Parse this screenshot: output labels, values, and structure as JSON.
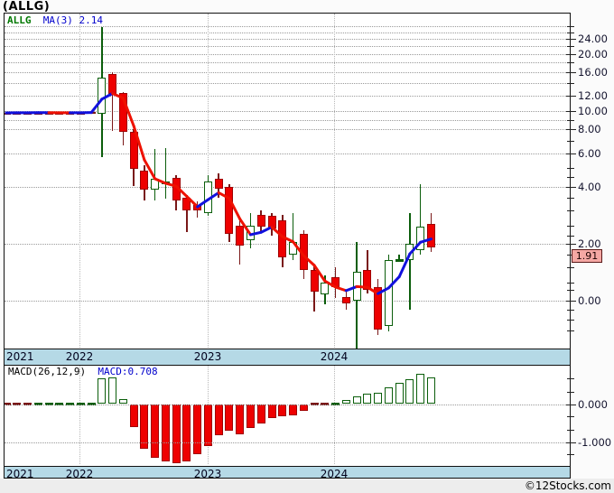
{
  "title": "(ALLG)",
  "legend": {
    "symbol": "ALLG",
    "ma_label": "MA(3)",
    "ma_value": "2.14"
  },
  "price_badge": "1.91",
  "watermark": "©12Stocks.com",
  "x_axis": {
    "years": [
      "2021",
      "2022",
      "2023",
      "2024"
    ]
  },
  "y_axis_main": {
    "labels": [
      {
        "text": "24.00",
        "v": 24
      },
      {
        "text": "20.00",
        "v": 20
      },
      {
        "text": "16.00",
        "v": 16
      },
      {
        "text": "12.00",
        "v": 12
      },
      {
        "text": "10.00",
        "v": 10
      },
      {
        "text": "8.00",
        "v": 8
      },
      {
        "text": "6.00",
        "v": 6
      },
      {
        "text": "4.00",
        "v": 4
      },
      {
        "text": "2.00",
        "v": 2
      },
      {
        "text": "0.00",
        "v": 1.0
      }
    ]
  },
  "macd_header": {
    "label": "MACD(26,12,9)",
    "value_label": "MACD:0.708"
  },
  "y_axis_macd": {
    "labels": [
      {
        "text": "0.000",
        "v": 0
      },
      {
        "text": "-1.000",
        "v": -1
      }
    ]
  },
  "colors": {
    "up_outline": "#0b5e0b",
    "down_fill": "#ee0000",
    "down_border": "#a00000",
    "wick_down": "#7a1818",
    "wick_up": "#0b5e0b",
    "ma_up": "#1111dd",
    "ma_down": "#ee1100",
    "band_bg": "#b5d9e6",
    "badge_bg": "#f5a8a4",
    "legend_symbol": "#007700",
    "legend_value": "#0000cc",
    "macd_label": "#000000",
    "macd_value": "#0000cc"
  },
  "chart_data": {
    "type": "candlestick_with_macd_histogram",
    "scale": "log",
    "interval_per_bar": "monthly",
    "ma_period": 3,
    "last_price": 1.91,
    "y_range_main": [
      0.55,
      28
    ],
    "y_range_macd": [
      -1.62,
      1.0
    ],
    "candles": [
      {
        "o": 9.79,
        "h": 9.85,
        "l": 9.75,
        "c": 9.79,
        "t": "dr"
      },
      {
        "o": 9.79,
        "h": 9.84,
        "l": 9.74,
        "c": 9.8,
        "t": "dr"
      },
      {
        "o": 9.8,
        "h": 9.85,
        "l": 9.76,
        "c": 9.81,
        "t": "dr"
      },
      {
        "o": 9.81,
        "h": 9.86,
        "l": 9.77,
        "c": 9.81,
        "t": "dr"
      },
      {
        "o": 9.81,
        "h": 9.85,
        "l": 9.76,
        "c": 9.8,
        "t": "dr"
      },
      {
        "o": 9.8,
        "h": 9.84,
        "l": 9.75,
        "c": 9.79,
        "t": "dr"
      },
      {
        "o": 9.79,
        "h": 9.85,
        "l": 9.76,
        "c": 9.8,
        "t": "dr"
      },
      {
        "o": 9.8,
        "h": 9.86,
        "l": 9.77,
        "c": 9.81,
        "t": "dr"
      },
      {
        "o": 9.81,
        "h": 9.9,
        "l": 9.78,
        "c": 9.85,
        "t": "dr"
      },
      {
        "o": 9.7,
        "h": 27.8,
        "l": 5.7,
        "c": 15.0,
        "t": "w"
      },
      {
        "o": 15.6,
        "h": 16.0,
        "l": 7.9,
        "c": 12.3,
        "t": "r"
      },
      {
        "o": 12.4,
        "h": 12.6,
        "l": 6.6,
        "c": 7.8,
        "t": "r"
      },
      {
        "o": 7.8,
        "h": 8.0,
        "l": 4.05,
        "c": 4.95,
        "t": "r"
      },
      {
        "o": 4.85,
        "h": 5.2,
        "l": 3.4,
        "c": 3.85,
        "t": "r"
      },
      {
        "o": 3.85,
        "h": 6.3,
        "l": 3.4,
        "c": 4.4,
        "t": "w"
      },
      {
        "o": 4.25,
        "h": 6.35,
        "l": 3.45,
        "c": 4.25,
        "t": "g"
      },
      {
        "o": 4.45,
        "h": 4.6,
        "l": 3.0,
        "c": 3.4,
        "t": "r"
      },
      {
        "o": 3.5,
        "h": 3.6,
        "l": 2.3,
        "c": 3.0,
        "t": "r"
      },
      {
        "o": 3.2,
        "h": 3.35,
        "l": 2.75,
        "c": 3.0,
        "t": "r"
      },
      {
        "o": 2.9,
        "h": 4.6,
        "l": 2.8,
        "c": 4.25,
        "t": "w"
      },
      {
        "o": 4.4,
        "h": 4.7,
        "l": 3.5,
        "c": 3.9,
        "t": "r"
      },
      {
        "o": 4.0,
        "h": 4.1,
        "l": 2.05,
        "c": 2.25,
        "t": "r"
      },
      {
        "o": 2.5,
        "h": 2.65,
        "l": 1.55,
        "c": 1.95,
        "t": "r"
      },
      {
        "o": 2.1,
        "h": 2.9,
        "l": 1.9,
        "c": 2.5,
        "t": "w"
      },
      {
        "o": 2.85,
        "h": 3.0,
        "l": 2.3,
        "c": 2.45,
        "t": "r"
      },
      {
        "o": 2.8,
        "h": 2.9,
        "l": 2.2,
        "c": 2.4,
        "t": "r"
      },
      {
        "o": 2.65,
        "h": 2.85,
        "l": 1.5,
        "c": 1.7,
        "t": "r"
      },
      {
        "o": 1.75,
        "h": 2.9,
        "l": 1.65,
        "c": 2.05,
        "t": "w"
      },
      {
        "o": 2.25,
        "h": 2.35,
        "l": 1.3,
        "c": 1.45,
        "t": "r"
      },
      {
        "o": 1.46,
        "h": 1.52,
        "l": 0.88,
        "c": 1.12,
        "t": "r"
      },
      {
        "o": 1.08,
        "h": 1.37,
        "l": 0.96,
        "c": 1.25,
        "t": "w"
      },
      {
        "o": 1.33,
        "h": 1.5,
        "l": 1.04,
        "c": 1.18,
        "t": "r"
      },
      {
        "o": 1.05,
        "h": 1.15,
        "l": 0.9,
        "c": 0.97,
        "t": "r"
      },
      {
        "o": 1.0,
        "h": 2.05,
        "l": 0.55,
        "c": 1.42,
        "t": "w"
      },
      {
        "o": 1.46,
        "h": 1.85,
        "l": 1.1,
        "c": 1.15,
        "t": "r"
      },
      {
        "o": 1.18,
        "h": 1.3,
        "l": 0.66,
        "c": 0.71,
        "t": "r"
      },
      {
        "o": 0.74,
        "h": 1.75,
        "l": 0.69,
        "c": 1.65,
        "t": "w"
      },
      {
        "o": 1.66,
        "h": 1.75,
        "l": 1.6,
        "c": 1.66,
        "t": "g"
      },
      {
        "o": 1.65,
        "h": 2.9,
        "l": 0.9,
        "c": 2.0,
        "t": "w"
      },
      {
        "o": 1.85,
        "h": 4.1,
        "l": 1.75,
        "c": 2.45,
        "t": "w"
      },
      {
        "o": 2.55,
        "h": 2.9,
        "l": 1.82,
        "c": 1.91,
        "t": "r"
      }
    ],
    "macd_histogram": [
      -0.01,
      -0.01,
      -0.005,
      0.005,
      0.005,
      0.005,
      0.005,
      0.01,
      0.02,
      0.67,
      0.7,
      0.12,
      -0.6,
      -1.18,
      -1.42,
      -1.52,
      -1.57,
      -1.5,
      -1.31,
      -1.1,
      -0.83,
      -0.71,
      -0.79,
      -0.62,
      -0.5,
      -0.38,
      -0.33,
      -0.29,
      -0.19,
      -0.05,
      -0.03,
      0.02,
      0.11,
      0.21,
      0.27,
      0.29,
      0.44,
      0.55,
      0.65,
      0.79,
      0.71
    ]
  }
}
